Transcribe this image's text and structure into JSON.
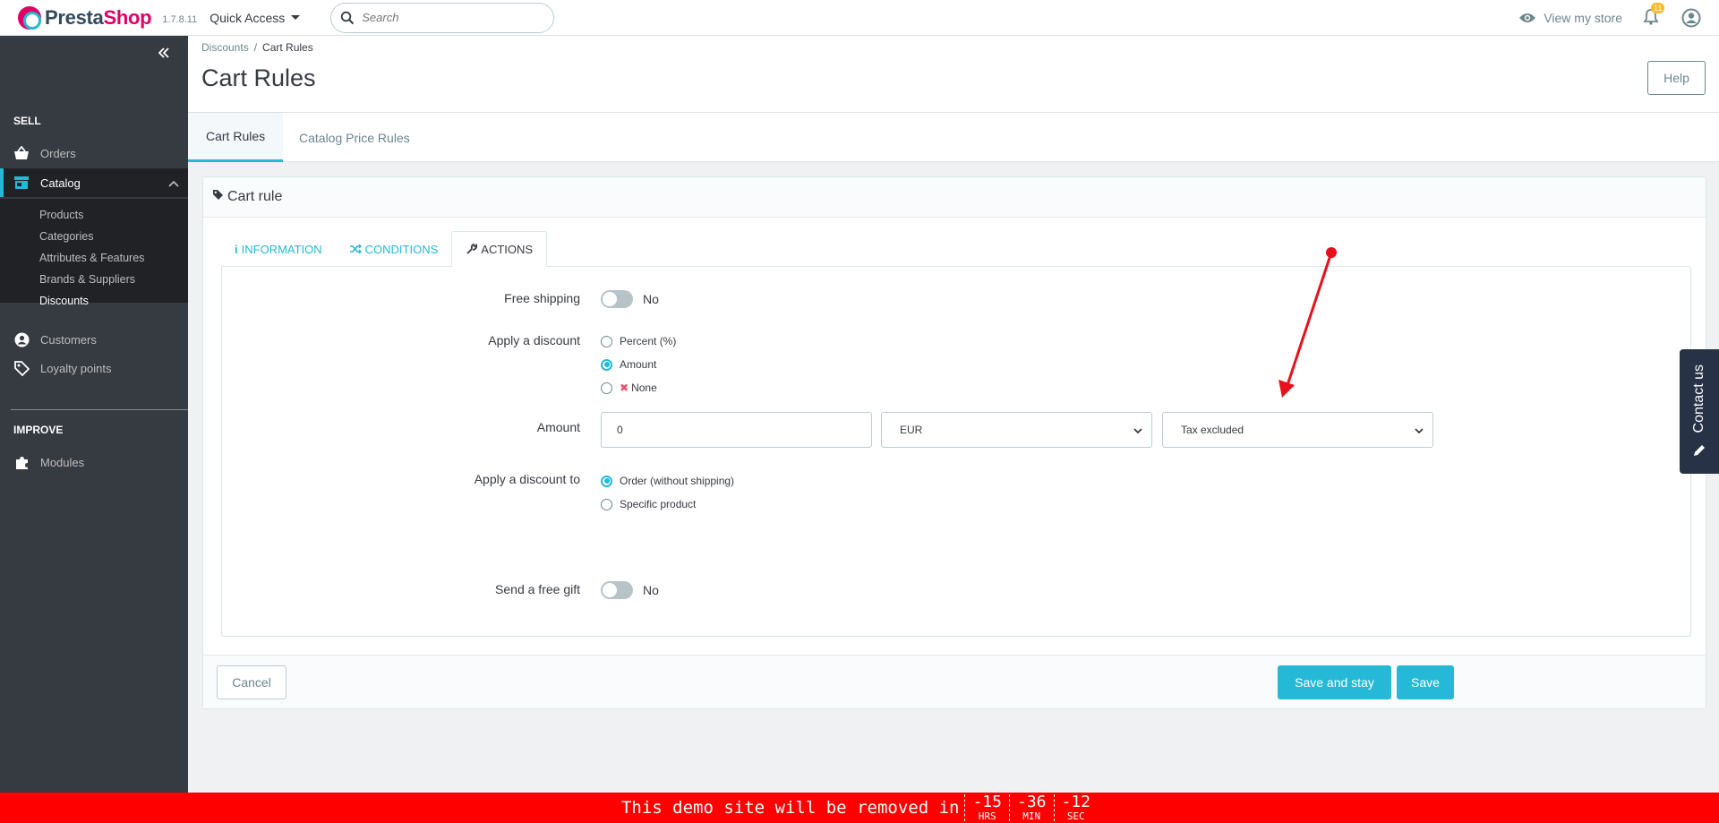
{
  "topbar": {
    "brand_presta": "Presta",
    "brand_shop": "Shop",
    "version": "1.7.8.11",
    "quick_access": "Quick Access",
    "search_placeholder": "Search",
    "view_store": "View my store",
    "notification_count": "11"
  },
  "sidebar": {
    "collapse_icon": "double-chevron-left-icon",
    "sell_title": "SELL",
    "orders": "Orders",
    "catalog": "Catalog",
    "catalog_sub": [
      "Products",
      "Categories",
      "Attributes & Features",
      "Brands & Suppliers",
      "Discounts"
    ],
    "customers": "Customers",
    "loyalty": "Loyalty points",
    "improve_title": "IMPROVE",
    "modules": "Modules"
  },
  "header": {
    "breadcrumb_parent": "Discounts",
    "breadcrumb_current": "Cart Rules",
    "title": "Cart Rules",
    "help": "Help"
  },
  "page_tabs": [
    "Cart Rules",
    "Catalog Price Rules"
  ],
  "panel": {
    "heading": "Cart rule",
    "tabs": [
      "INFORMATION",
      "CONDITIONS",
      "ACTIONS"
    ],
    "free_shipping_label": "Free shipping",
    "free_shipping_value": "No",
    "apply_discount_label": "Apply a discount",
    "discount_options": [
      "Percent (%)",
      "Amount",
      "None"
    ],
    "discount_selected": "Amount",
    "amount_label": "Amount",
    "amount_value": "0",
    "currency_value": "EUR",
    "tax_value": "Tax excluded",
    "apply_to_label": "Apply a discount to",
    "apply_to_options": [
      "Order (without shipping)",
      "Specific product"
    ],
    "apply_to_selected": "Order (without shipping)",
    "free_gift_label": "Send a free gift",
    "free_gift_value": "No",
    "cancel": "Cancel",
    "save_and_stay": "Save and stay",
    "save": "Save"
  },
  "contact_tab": "Contact us",
  "demo_bar": {
    "message": "This demo site will be removed in",
    "hours": "-15",
    "hours_unit": "HRS",
    "minutes": "-36",
    "minutes_unit": "MIN",
    "seconds": "-12",
    "seconds_unit": "SEC"
  },
  "colors": {
    "accent": "#25b9d7",
    "sidebar": "#363a41",
    "brand": "#df0067",
    "demo_bar": "#ff0000",
    "annotation_arrow": "#e8101a"
  }
}
